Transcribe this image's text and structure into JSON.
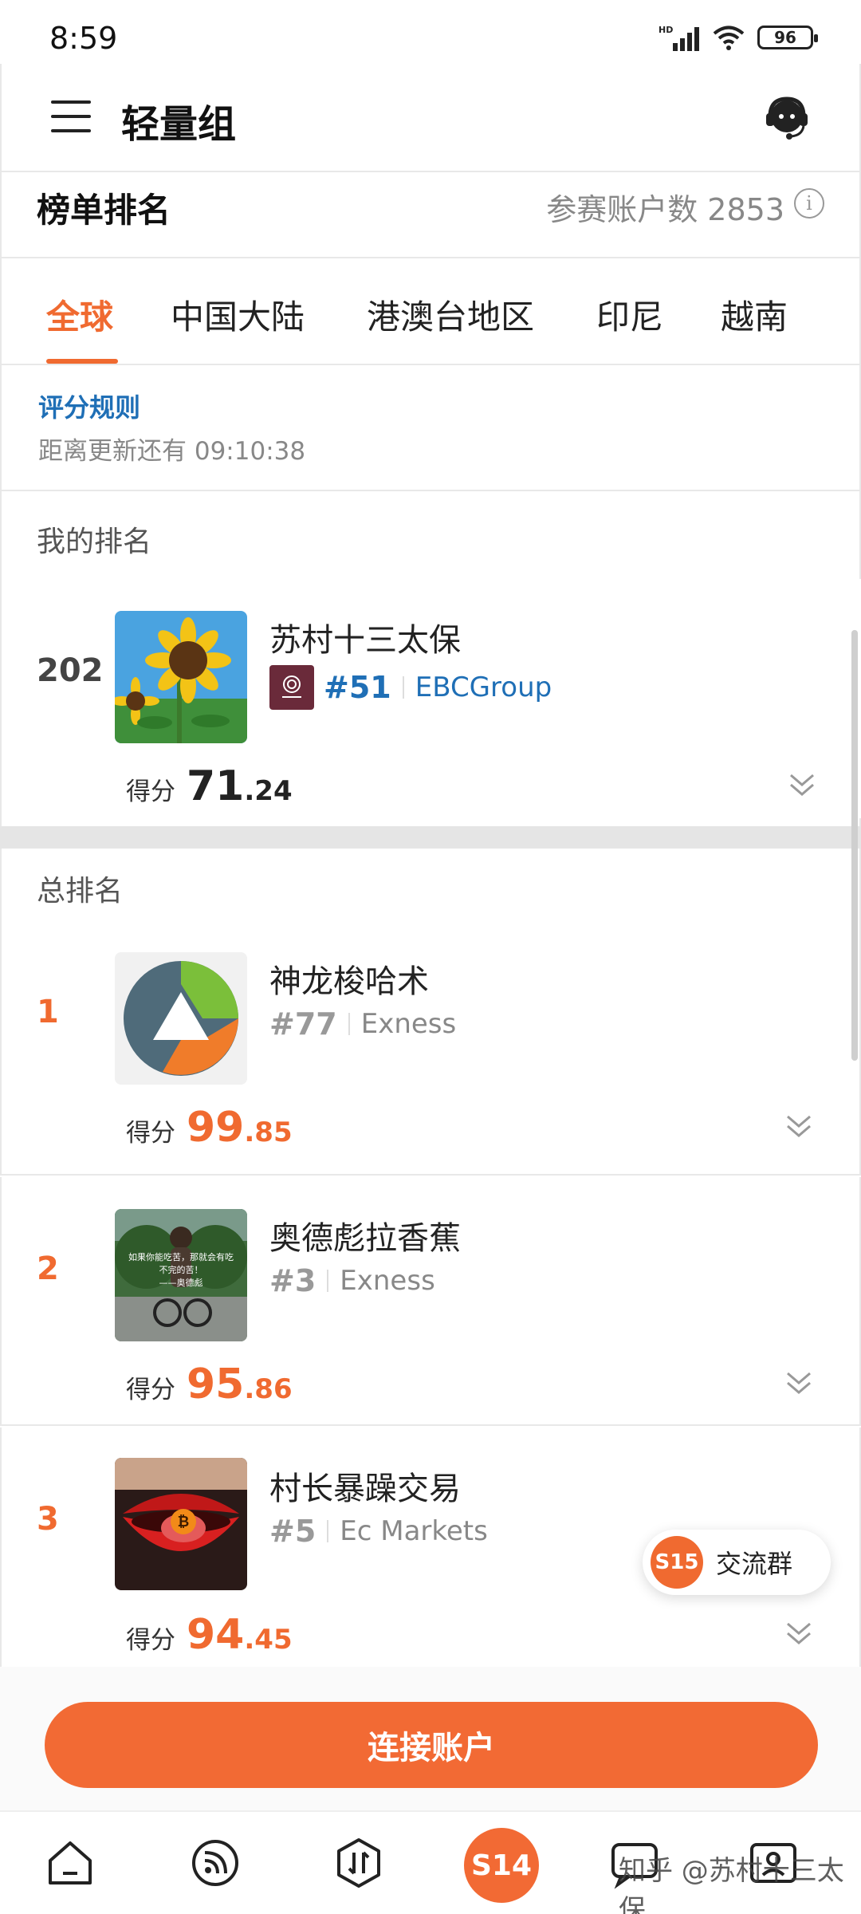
{
  "status_bar": {
    "time": "8:59",
    "battery": "96",
    "network_label": "HD"
  },
  "header": {
    "title": "轻量组",
    "menu_icon": "menu-icon",
    "support_icon": "headset-icon"
  },
  "board": {
    "title": "榜单排名",
    "participants": "参赛账户数 2853",
    "info_icon": "i"
  },
  "tabs": [
    {
      "label": "全球",
      "active": true
    },
    {
      "label": "中国大陆"
    },
    {
      "label": "港澳台地区"
    },
    {
      "label": "印尼"
    },
    {
      "label": "越南"
    }
  ],
  "rules": {
    "link": "评分规则",
    "update": "距离更新还有 09:10:38"
  },
  "my_ranking": {
    "section_title": "我的排名",
    "rank": "202",
    "name": "苏村十三太保",
    "broker_rank": "#51",
    "broker": "EBCGroup",
    "score_label": "得分",
    "score_int": "71",
    "score_dec": ".24"
  },
  "overall": {
    "section_title": "总排名",
    "entries": [
      {
        "rank": "1",
        "name": "神龙梭哈术",
        "broker_rank": "#77",
        "broker": "Exness",
        "score_label": "得分",
        "score_int": "99",
        "score_dec": ".85"
      },
      {
        "rank": "2",
        "name": "奥德彪拉香蕉",
        "broker_rank": "#3",
        "broker": "Exness",
        "score_label": "得分",
        "score_int": "95",
        "score_dec": ".86",
        "avatar_text": [
          "如果你能吃苦，那就会有吃",
          "不完的苦！",
          "——奥德彪"
        ]
      },
      {
        "rank": "3",
        "name": "村长暴躁交易",
        "broker_rank": "#5",
        "broker": "Ec Markets",
        "score_label": "得分",
        "score_int": "94",
        "score_dec": ".45"
      }
    ]
  },
  "group_chat": {
    "badge": "S15",
    "label": "交流群"
  },
  "connect_button": "连接账户",
  "bottom_nav": {
    "center_label": "S14",
    "watermark": "知乎 @苏村十三太保"
  },
  "colors": {
    "accent": "#f06a30",
    "link": "#1f6fb6",
    "muted": "#888888"
  }
}
